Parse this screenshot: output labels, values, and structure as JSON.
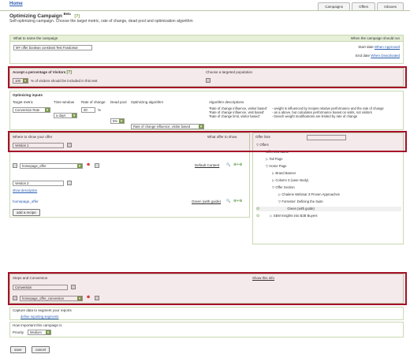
{
  "header": {
    "home_link": "Home",
    "tabs": [
      {
        "label": "Campaigns"
      },
      {
        "label": "Offers"
      },
      {
        "label": "Inboxes"
      }
    ],
    "title": "Optimizing Campaign",
    "title_suffix": "Beta",
    "subtitle": "Self-optimizing campaign. Choose the target metric, rate of change, dead pool and optimization algorithm"
  },
  "campaign_name": {
    "label": "What to name the campaign",
    "value": "MY offer boolean constrast Test Fandomar",
    "right_label": "When the campaign should run",
    "start_label": "Start date",
    "start_value": "When Approved",
    "end_label": "End date",
    "end_value": "When Deactivated"
  },
  "visitors": {
    "label": "Accept a percentage of Visitors",
    "percent_value": "100",
    "percent_text": "% of visitors should be included in this test",
    "population_label": "Choose a targeted population"
  },
  "optimizing_inputs": {
    "label": "Optimizing inputs",
    "col_target": "Target metric",
    "col_window": "Time window",
    "col_rate": "Rate of change",
    "col_dead": "Dead pool",
    "col_algo": "Optimizing algorithm",
    "col_desc": "Algorithm descriptions",
    "target_value": "Conversion Rate",
    "window_value": "a days",
    "rate_value": "20",
    "rate_unit": "%",
    "dead_value": "5%",
    "algo_value": "Rate of change influence, visitor based",
    "descriptions": [
      {
        "name": "'Rate of change influence, visitor based'",
        "text": "- weight is influenced by recipes relative performance and the rate of change"
      },
      {
        "name": "'Rate of change influence, visit based'",
        "text": "- as a above, but calculates performance based on visits, not visitors"
      },
      {
        "name": "'Rate of change limit, visitor based'",
        "text": "- branch weight modifications are limited by rate of change"
      }
    ]
  },
  "where_offer": {
    "label": "Where to show your offer",
    "what_offer_label": "What offer to show",
    "version1_value": "Version 1",
    "offer1_value": "homepage_offer",
    "default_content": "Default Content",
    "version2_value": "Version 2",
    "show_description": "show description",
    "offer2_text": "homepage_offer",
    "green_link": "Green (with guide)",
    "add_recipe": "add a recipe"
  },
  "offer_list": {
    "header": "Offer lists",
    "search_placeholder": "",
    "items": [
      {
        "label": "Offers"
      },
      {
        "label": "Offer List Name"
      },
      {
        "label": "Tail Page"
      },
      {
        "label": "Home Page"
      },
      {
        "label": "Brand Banner"
      },
      {
        "label": "Column 3 (case study)"
      },
      {
        "label": "Offer Section"
      },
      {
        "label": "Chalene Webinar 3 Proven Approaches"
      },
      {
        "label": "Forrester: Defining the Suite"
      },
      {
        "label": "Green (with guide)"
      },
      {
        "label": "SEM Insights into B2B Buyers"
      }
    ]
  },
  "steps": {
    "label": "Steps and Conversion",
    "show_link": "Show this info",
    "conversion_value": "Conversion",
    "offer_value": "homepage_offer_conversion"
  },
  "segment": {
    "label": "Capture data to segment your reports",
    "link": "define reporting segments"
  },
  "priority": {
    "label": "How important this campaign is",
    "priority_label": "Priority",
    "priority_value": "Medium"
  },
  "footer": {
    "save": "save",
    "cancel": "cancel"
  },
  "colors": {
    "header_green": "#e6efd8",
    "accent_green": "#7a9a48",
    "highlight_red": "#a5102a",
    "link_blue": "#2a5db0"
  }
}
